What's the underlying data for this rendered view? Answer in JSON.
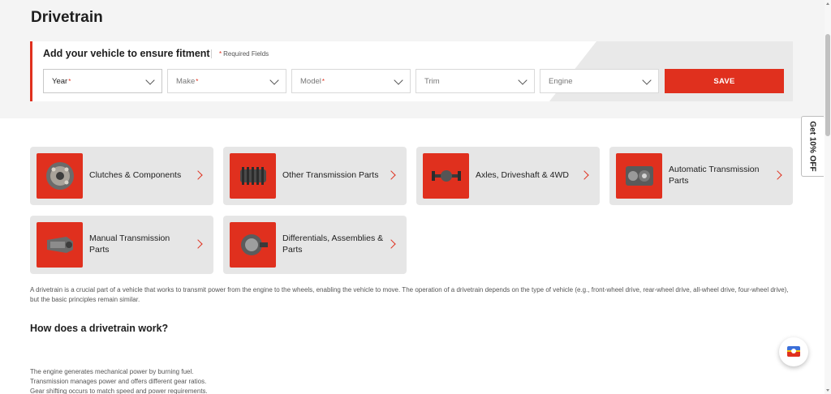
{
  "page": {
    "title": "Drivetrain"
  },
  "fitment": {
    "title": "Add your vehicle to ensure fitment",
    "required_marker": "*",
    "required_note": "Required Fields",
    "selects": [
      {
        "label": "Year",
        "required": "*"
      },
      {
        "label": "Make",
        "required": "*"
      },
      {
        "label": "Model",
        "required": "*"
      },
      {
        "label": "Trim",
        "required": ""
      },
      {
        "label": "Engine",
        "required": ""
      }
    ],
    "save_label": "SAVE"
  },
  "categories": [
    {
      "label": "Clutches & Components",
      "icon": "clutch-icon"
    },
    {
      "label": "Other Transmission Parts",
      "icon": "gear-icon"
    },
    {
      "label": "Axles, Driveshaft & 4WD",
      "icon": "axle-icon"
    },
    {
      "label": "Automatic Transmission Parts",
      "icon": "transmission-icon"
    },
    {
      "label": "Manual Transmission Parts",
      "icon": "gearbox-icon"
    },
    {
      "label": "Differentials, Assemblies & Parts",
      "icon": "differential-icon"
    }
  ],
  "article": {
    "intro": "A drivetrain is a crucial part of a vehicle that works to transmit power from the engine to the wheels, enabling the vehicle to move. The operation of a drivetrain depends on the type of vehicle (e.g., front-wheel drive, rear-wheel drive, all-wheel drive, four-wheel drive), but the basic principles remain similar.",
    "heading": "How does a drivetrain work?",
    "steps": [
      "The engine generates mechanical power by burning fuel.",
      "Transmission manages power and offers different gear ratios.",
      "Gear shifting occurs to match speed and power requirements."
    ]
  },
  "promo_tab": {
    "label": "Get 10% OFF"
  },
  "chat": {
    "icon": "chat-widget-icon"
  },
  "colors": {
    "accent": "#e0301e",
    "tile_bg": "#e6e6e6",
    "band_bg": "#f4f4f4"
  }
}
